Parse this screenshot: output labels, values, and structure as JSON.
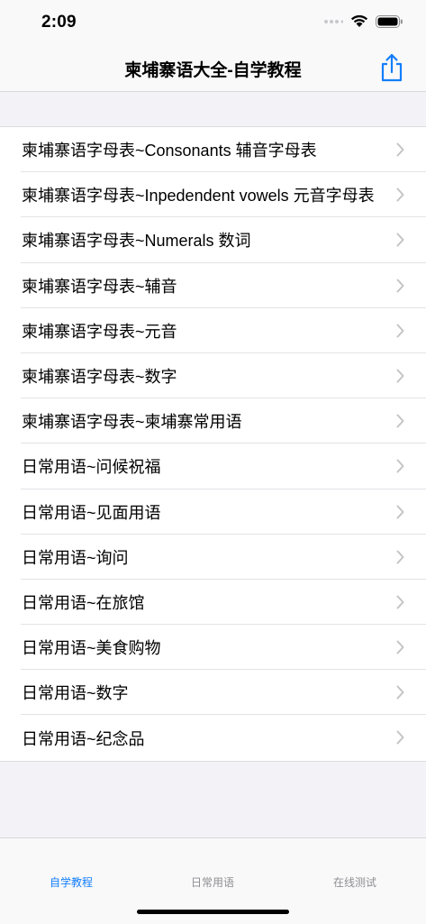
{
  "status_bar": {
    "time": "2:09"
  },
  "nav": {
    "title": "柬埔寨语大全-自学教程",
    "share_icon": "share-icon"
  },
  "colors": {
    "accent": "#147efb",
    "background": "#f2f2f7"
  },
  "list": {
    "items": [
      {
        "label": "柬埔寨语字母表~Consonants 辅音字母表"
      },
      {
        "label": "柬埔寨语字母表~Inpedendent vowels 元音字母表"
      },
      {
        "label": "柬埔寨语字母表~Numerals 数词"
      },
      {
        "label": "柬埔寨语字母表~辅音"
      },
      {
        "label": "柬埔寨语字母表~元音"
      },
      {
        "label": "柬埔寨语字母表~数字"
      },
      {
        "label": "柬埔寨语字母表~柬埔寨常用语"
      },
      {
        "label": "日常用语~问候祝福"
      },
      {
        "label": "日常用语~见面用语"
      },
      {
        "label": "日常用语~询问"
      },
      {
        "label": "日常用语~在旅馆"
      },
      {
        "label": "日常用语~美食购物"
      },
      {
        "label": "日常用语~数字"
      },
      {
        "label": "日常用语~纪念品"
      }
    ]
  },
  "tabs": [
    {
      "label": "自学教程",
      "active": true
    },
    {
      "label": "日常用语",
      "active": false
    },
    {
      "label": "在线测试",
      "active": false
    }
  ]
}
